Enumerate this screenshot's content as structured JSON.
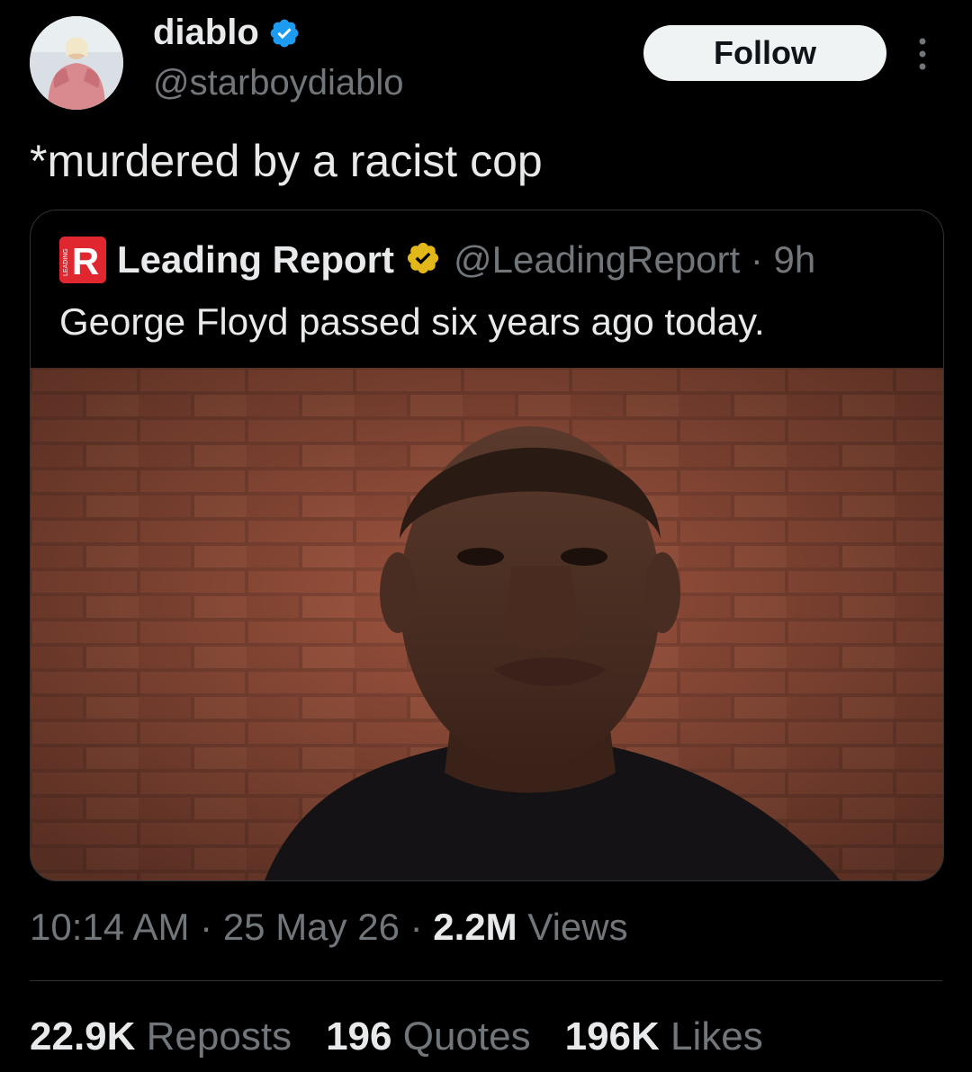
{
  "tweet": {
    "author_name": "diablo",
    "author_handle": "@starboydiablo",
    "follow_label": "Follow",
    "text": "*murdered by a racist cop",
    "time": "10:14 AM",
    "date": "25 May 26",
    "views_count": "2.2M",
    "views_label": "Views",
    "separator": "·"
  },
  "quote": {
    "author_name": "Leading Report",
    "handle_time": "@LeadingReport · 9h",
    "text": "George Floyd passed six years ago today.",
    "logo_letter": "R",
    "logo_small_text": "LEADING"
  },
  "stats": [
    {
      "count": "22.9K",
      "label": "Reposts"
    },
    {
      "count": "196",
      "label": "Quotes"
    },
    {
      "count": "196K",
      "label": "Likes"
    }
  ],
  "colors": {
    "background": "#000000",
    "text_primary": "#e7e9ea",
    "text_secondary": "#71767b",
    "verified_blue": "#1d9bf0",
    "verified_gold": "#e2b719",
    "follow_button_bg": "#eff3f4",
    "logo_red": "#e0262f"
  },
  "icons": [
    "verified-badge-icon",
    "gold-verified-badge-icon",
    "more-options-icon"
  ]
}
